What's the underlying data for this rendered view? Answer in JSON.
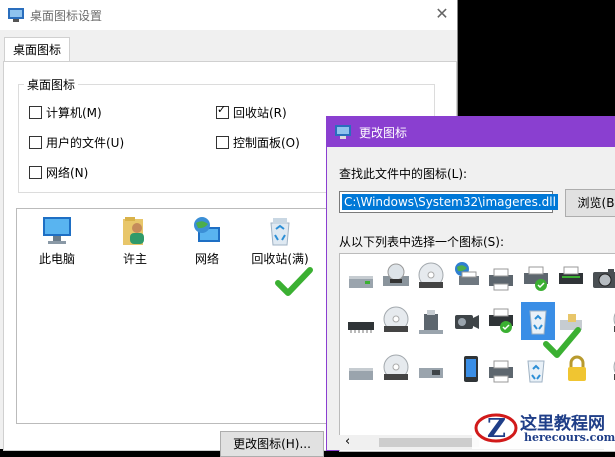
{
  "colors": {
    "accent_purple": "#8a3fd0",
    "selection_blue": "#0078d7",
    "check_green": "#3bb032",
    "watermark_red": "#d11a1a",
    "watermark_blue": "#1f3e88"
  },
  "desktop_icon_settings": {
    "title": "桌面图标设置",
    "close_glyph": "✕",
    "tab_label": "桌面图标",
    "group_label": "桌面图标",
    "checkboxes": [
      {
        "label": "计算机(M)",
        "checked": false
      },
      {
        "label": "回收站(R)",
        "checked": true
      },
      {
        "label": "用户的文件(U)",
        "checked": false
      },
      {
        "label": "控制面板(O)",
        "checked": false
      },
      {
        "label": "网络(N)",
        "checked": false
      }
    ],
    "icons": [
      {
        "label": "此电脑",
        "icon": "computer-icon"
      },
      {
        "label": "许主",
        "icon": "user-folder-icon"
      },
      {
        "label": "网络",
        "icon": "network-globe-icon"
      },
      {
        "label": "回收站(满)",
        "icon": "recycle-bin-full-icon"
      }
    ],
    "change_icon_button": "更改图标(H)..."
  },
  "change_icon_dialog": {
    "title": "更改图标",
    "find_label": "查找此文件中的图标(L):",
    "path_value": "C:\\Windows\\System32\\imageres.dll",
    "browse_button": "浏览(B",
    "select_label": "从以下列表中选择一个图标(S):",
    "scroll_left": "‹",
    "icon_grid": [
      [
        "hdd-green-icon",
        "dvd-drive-icon",
        "dvd-rw-disc-icon",
        "network-printer-icon",
        "printer-icon",
        "printer-check-icon",
        "printer-icon",
        "camera-icon",
        "disc-icon"
      ],
      [
        "memory-chip-icon",
        "dvd-r-disc-icon",
        "usb-drive-icon",
        "camcorder-icon",
        "printer-check-icon",
        "recycle-bin-empty-icon",
        "card-reader-icon",
        "cd-disc-icon"
      ],
      [
        "hdd-icon",
        "dvd-ram-disc-icon",
        "usb-drive-icon",
        "smartphone-icon",
        "printer-icon",
        "recycle-bin-full-icon",
        "lock-icon",
        "cd-r-disc-icon"
      ]
    ]
  },
  "watermark": {
    "brand_cn": "这里教程网",
    "brand_url": "herecours.com"
  }
}
